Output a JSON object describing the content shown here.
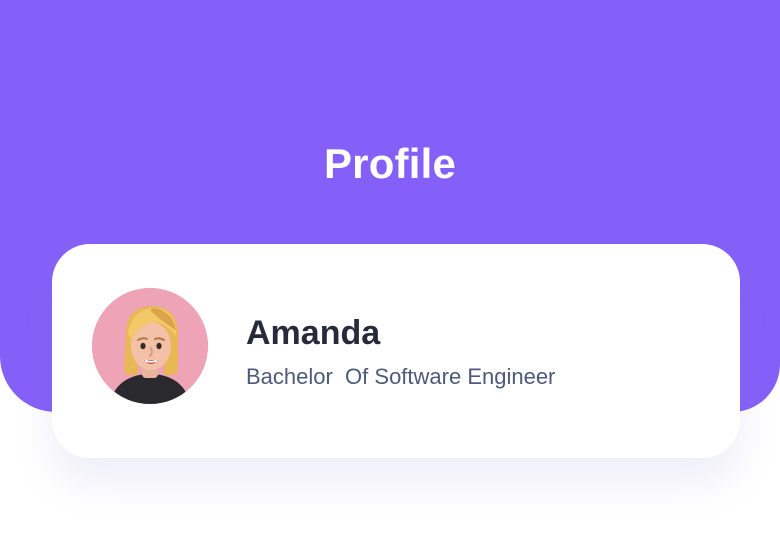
{
  "header": {
    "title": "Profile",
    "background_color": "#8560f8"
  },
  "profile_card": {
    "name": "Amanda",
    "degree": "Bachelor  Of Software Engineer",
    "avatar": {
      "icon": "avatar-illustration",
      "background_color": "#eea3b6"
    }
  }
}
